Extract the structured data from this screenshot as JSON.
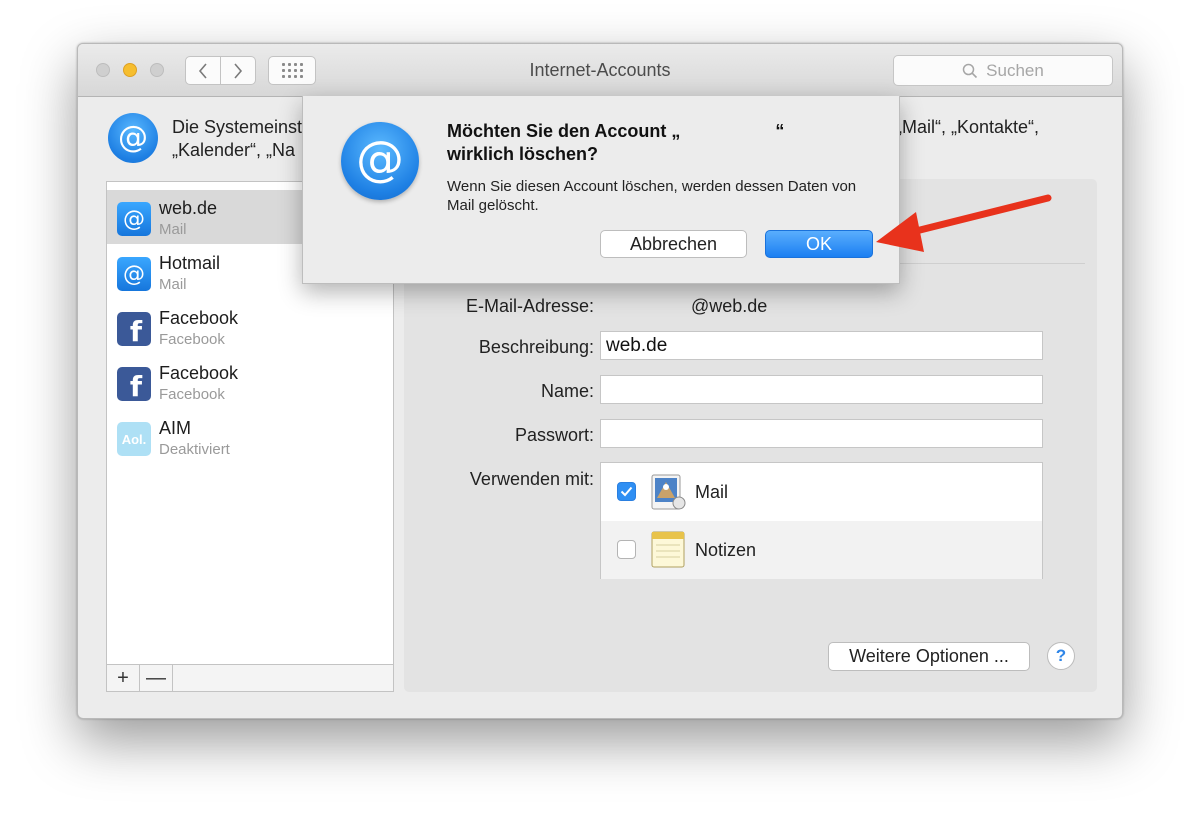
{
  "window": {
    "title": "Internet-Accounts",
    "search_placeholder": "Suchen"
  },
  "header": {
    "line1": "Die Systemeinst",
    "line2": "„Kalender“, „Na",
    "line1_right": "t „Mail“, „Kontakte“,"
  },
  "accounts": [
    {
      "name": "web.de",
      "type": "Mail",
      "icon": "at-icon",
      "selected": true
    },
    {
      "name": "Hotmail",
      "type": "Mail",
      "icon": "at-icon",
      "selected": false
    },
    {
      "name": "Facebook",
      "type": "Facebook",
      "icon": "facebook-icon",
      "selected": false
    },
    {
      "name": "Facebook",
      "type": "Facebook",
      "icon": "facebook-icon",
      "selected": false
    },
    {
      "name": "AIM",
      "type": "Deaktiviert",
      "icon": "aol-icon",
      "icon_text": "Aol.",
      "selected": false
    }
  ],
  "list_footer": {
    "add": "+",
    "remove": "—"
  },
  "detail": {
    "email_label": "E-Mail-Adresse:",
    "email_value": "@web.de",
    "description_label": "Beschreibung:",
    "description_value": "web.de",
    "name_label": "Name:",
    "name_value": "",
    "password_label": "Passwort:",
    "password_value": "",
    "use_with_label": "Verwenden mit:",
    "apps": [
      {
        "label": "Mail",
        "checked": true,
        "icon": "mail-app-icon"
      },
      {
        "label": "Notizen",
        "checked": false,
        "icon": "notes-app-icon"
      }
    ],
    "more_options": "Weitere Optionen ...",
    "help": "?"
  },
  "dialog": {
    "title_line1": "Möchten Sie den Account „                   “",
    "title_line2": "wirklich löschen?",
    "message": "Wenn Sie diesen Account löschen, werden dessen Daten von Mail gelöscht.",
    "cancel": "Abbrechen",
    "ok": "OK"
  },
  "colors": {
    "accent": "#1b7ff2",
    "arrow": "#e8321c",
    "selection": "#d9d9d9"
  }
}
